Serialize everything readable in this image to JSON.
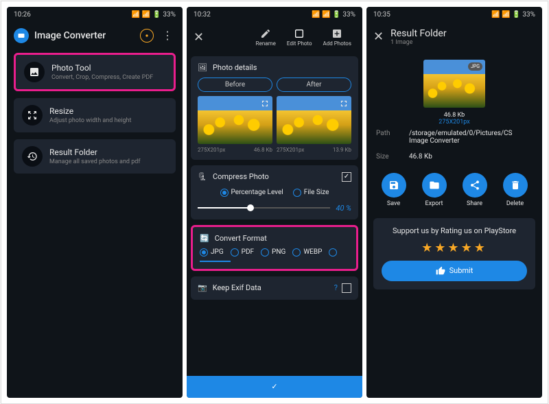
{
  "status": {
    "t1": "10:26",
    "t2": "10:32",
    "t3": "10:35",
    "batt": "33%"
  },
  "screen1": {
    "title": "Image Converter",
    "cards": [
      {
        "title": "Photo Tool",
        "sub": "Convert, Crop, Compress, Create PDF"
      },
      {
        "title": "Resize",
        "sub": "Adjust photo width and height"
      },
      {
        "title": "Result Folder",
        "sub": "Manage all saved photos and pdf"
      }
    ]
  },
  "screen2": {
    "toolbar": [
      "Rename",
      "Edit Photo",
      "Add Photos"
    ],
    "details": {
      "title": "Photo details",
      "before": "Before",
      "after": "After",
      "b_dim": "275X201px",
      "b_size": "46.8 Kb",
      "a_dim": "275X201px",
      "a_size": "13.9 Kb"
    },
    "compress": {
      "title": "Compress Photo",
      "opt1": "Percentage Level",
      "opt2": "File Size",
      "value": "40 %"
    },
    "convert": {
      "title": "Convert Format",
      "formats": [
        "JPG",
        "PDF",
        "PNG",
        "WEBP"
      ]
    },
    "exif": "Keep Exif Data"
  },
  "screen3": {
    "title": "Result Folder",
    "subtitle": "1 Image",
    "badge": "JPG",
    "size": "46.8 Kb",
    "dim": "275X201px",
    "path_label": "Path",
    "path": "/storage/emulated/0/Pictures/CS Image Converter",
    "size_label": "Size",
    "size_val": "46.8 Kb",
    "actions": [
      "Save",
      "Export",
      "Share",
      "Delete"
    ],
    "support": "Support us by Rating us on PlayStore",
    "submit": "Submit"
  }
}
